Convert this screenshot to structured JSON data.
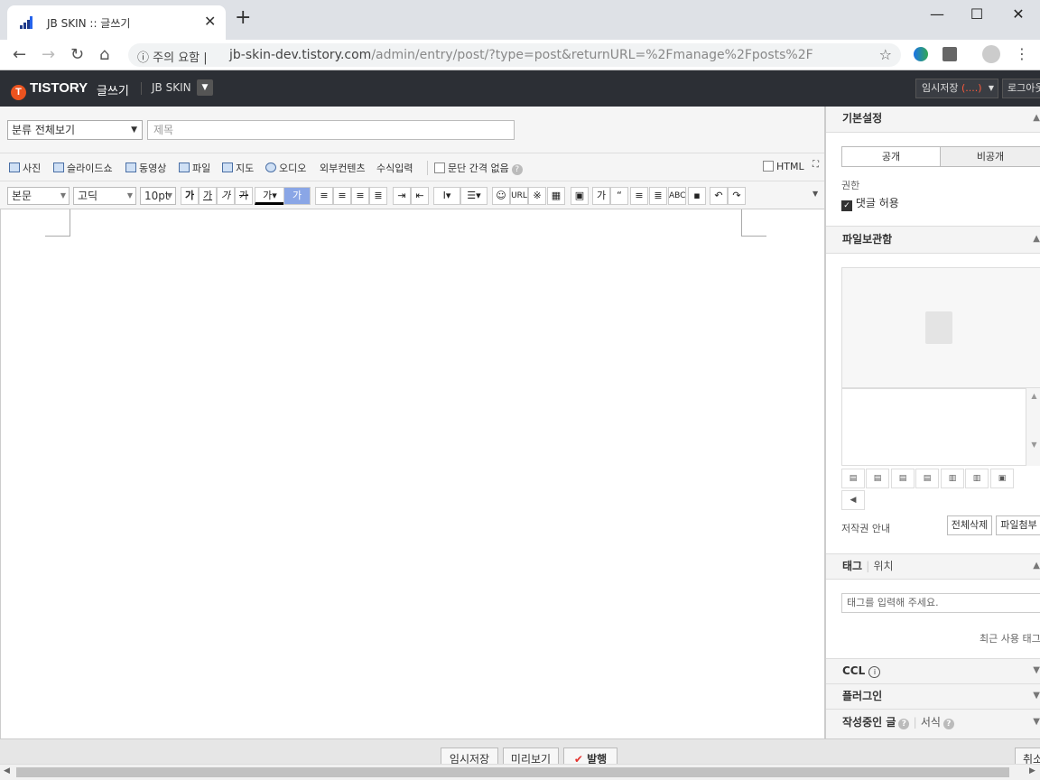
{
  "browser": {
    "tab_title": "JB SKIN :: 글쓰기",
    "security": "주의 요함",
    "url_host": "jb-skin-dev.tistory.com",
    "url_path": "/admin/entry/post/?type=post&returnURL=%2Fmanage%2Fposts%2F"
  },
  "header": {
    "logo": "TISTORY",
    "write": "글쓰기",
    "blog_name": "JB SKIN",
    "temp_save": "임시저장",
    "temp_save_count": "(....)",
    "login": "로그아웃"
  },
  "editor": {
    "category": "분류 전체보기",
    "title_placeholder": "제목",
    "insert": {
      "photo": "사진",
      "slideshow": "슬라이드쇼",
      "video": "동영상",
      "file": "파일",
      "map": "지도",
      "audio": "오디오",
      "external": "외부컨텐츠",
      "formula": "수식입력",
      "no_spacing": "문단 간격 없음",
      "html": "HTML"
    },
    "format": {
      "style": "본문",
      "font": "고딕",
      "size": "10pt",
      "url": "URL"
    }
  },
  "sidebar": {
    "basic": "기본설정",
    "public": "공개",
    "private": "비공개",
    "permission": "권한",
    "allow_comment": "댓글 허용",
    "filebox": "파일보관함",
    "copyright": "저작권 안내",
    "delete_all": "전체삭제",
    "attach_file": "파일첨부",
    "tag": "태그",
    "location": "위치",
    "tag_placeholder": "태그를 입력해 주세요.",
    "recent_tags": "최근 사용 태그",
    "ccl": "CCL",
    "plugin": "플러그인",
    "writing": "작성중인 글",
    "format": "서식"
  },
  "bottom": {
    "temp_save": "임시저장",
    "preview": "미리보기",
    "publish": "발행",
    "cancel": "취소"
  }
}
